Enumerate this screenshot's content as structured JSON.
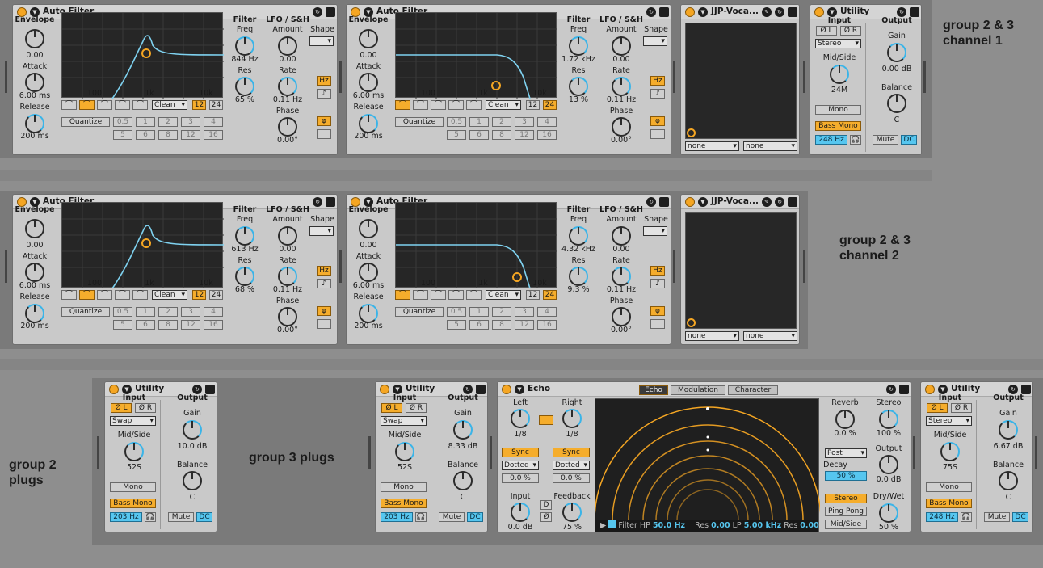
{
  "notes": {
    "top": "group 2 & 3\nchannel 1",
    "mid": "group 2 & 3\nchannel 2",
    "g2": "group 2\nplugs",
    "g3": "group 3 plugs"
  },
  "af": {
    "title": "Auto Filter",
    "envelope": "Envelope",
    "env_val": "0.00",
    "attack": "Attack",
    "attack_val": "6.00 ms",
    "release": "Release",
    "release_val": "200 ms",
    "filter": "Filter",
    "freq": "Freq",
    "res": "Res",
    "lfo": "LFO / S&H",
    "shape": "Shape",
    "amount": "Amount",
    "amount_val": "0.00",
    "rate": "Rate",
    "rate_val": "0.11 Hz",
    "phase": "Phase",
    "phase_val": "0.00°",
    "hz": "Hz",
    "note_sym": "♪",
    "phi": "φ",
    "clean": "Clean",
    "n12": "12",
    "n24": "24",
    "quantize": "Quantize",
    "q1": [
      "0.5",
      "1",
      "2",
      "3",
      "4"
    ],
    "q2": [
      "5",
      "6",
      "8",
      "12",
      "16"
    ],
    "ticks": [
      "100",
      "1k",
      "10k"
    ]
  },
  "af_units": [
    {
      "freq": "844 Hz",
      "res": "65 %"
    },
    {
      "freq": "1.72 kHz",
      "res": "13 %"
    },
    {
      "freq": "613 Hz",
      "res": "68 %"
    },
    {
      "freq": "4.32 kHz",
      "res": "9.3 %"
    }
  ],
  "jjp": {
    "title": "JJP-Voca...",
    "none1": "none",
    "none2": "none"
  },
  "util": {
    "title": "Utility",
    "input": "Input",
    "output": "Output",
    "phl": "Ø L",
    "phr": "Ø R",
    "midside": "Mid/Side",
    "gain": "Gain",
    "balance": "Balance",
    "bal_val": "C",
    "mono": "Mono",
    "bassmono": "Bass Mono",
    "mute": "Mute",
    "dc": "DC",
    "headphone": "🎧"
  },
  "util_units": [
    {
      "mode": "Stereo",
      "ms": "24M",
      "gain": "0.00 dB",
      "hz": "248 Hz"
    },
    {
      "mode": "Swap",
      "ms": "52S",
      "gain": "10.0 dB",
      "hz": "203 Hz"
    },
    {
      "mode": "Swap",
      "ms": "52S",
      "gain": "8.33 dB",
      "hz": "203 Hz"
    },
    {
      "mode": "Stereo",
      "ms": "75S",
      "gain": "6.67 dB",
      "hz": "248 Hz"
    }
  ],
  "echo": {
    "title": "Echo",
    "left": "Left",
    "right": "Right",
    "left_val": "1/8",
    "right_val": "1/8",
    "sync": "Sync",
    "dotted": "Dotted",
    "pct": "0.0 %",
    "input": "Input",
    "input_val": "0.0 dB",
    "feedback": "Feedback",
    "feedback_val": "75 %",
    "d": "D",
    "phi": "Ø",
    "tabs": [
      "Echo",
      "Modulation",
      "Character"
    ],
    "reverb": "Reverb",
    "reverb_val": "0.0 %",
    "stereo": "Stereo",
    "stereo_val": "100 %",
    "post": "Post",
    "decay": "Decay",
    "decay_val": "50 %",
    "output": "Output",
    "output_val": "0.0 dB",
    "stereo_btn": "Stereo",
    "pingpong": "Ping Pong",
    "midside": "Mid/Side",
    "drywet": "Dry/Wet",
    "drywet_val": "50 %",
    "filter_hp": "Filter HP",
    "hp_val": "50.0 Hz",
    "res": "Res",
    "res_val": "0.00",
    "lp": "LP",
    "lp_val": "5.00 kHz",
    "res2_val": "0.00"
  }
}
